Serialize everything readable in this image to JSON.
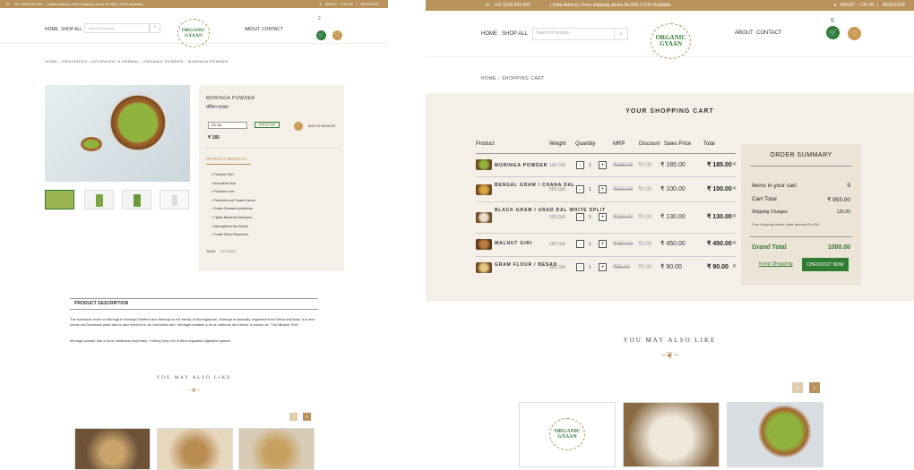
{
  "topbar": {
    "phone": "+91 9150 943 943",
    "promo": "| India delivery | Free shipping above Rs.600 | COD Available",
    "pincode": "400007",
    "login": "LOG IN",
    "register": "REGISTER"
  },
  "nav": {
    "home": "HOME",
    "shop_all": "SHOP ALL",
    "search_placeholder": "Search Products",
    "logo_line1": "ORGANIC",
    "logo_line2": "GYAAN",
    "about": "ABOUT",
    "contact": "CONTACT",
    "cart_count_left": "2",
    "cart_count_right": "5"
  },
  "product_page": {
    "breadcrumb": "HOME › GROCERIES › AYURVEDIC & HERBAL › ORGANIC POWDER › MORINGA POWDER",
    "name": "MORINGA POWDER",
    "name_local": "मोरिंगा पाउडर",
    "size_option": "100 GM",
    "add_to_cart": "Add to Cart",
    "add_to_wishlist": "ADD TO WISHLIST",
    "price": "₹ 185",
    "benefits_title": "PRODUCT BENEFITS",
    "benefits": [
      "Protects Skin",
      "Nourishes Hair",
      "Protects Liver",
      "Prevents and Treats Cancer",
      "Treats Stomach problems",
      "Fights Bacterial Diseases",
      "Strengthens the Bones",
      "Treats Mood Disorders"
    ],
    "tags_label": "TAGS:",
    "tag": "ORGANIC",
    "desc_title": "PRODUCT DESCRIPTION",
    "desc_p1": "The botanical name of Moringa is Moringa Oleifera and belongs to the family of Moringaceae. Moringa is basically originated from Africa and Asia. It is also known as Drumstick plant and is also referred to as Drumstick tree. Moringa contains a lot of nutrients and hence is known as \"The Miracle Tree\".",
    "desc_p2": "Moringa powder has a lot of medicinal properties. It being very rich in fibre regulates digestive system.",
    "also_like": "YOU MAY ALSO LIKE"
  },
  "cart_page": {
    "breadcrumb": "HOME › SHOPPING CART",
    "title": "YOUR SHOPPING CART",
    "headers": [
      "Product",
      "Weight",
      "Quantity",
      "MRP",
      "Discount",
      "Sales Price",
      "Total"
    ],
    "items": [
      {
        "name": "MORINGA POWDER",
        "weight": "100 GM",
        "qty": "1",
        "mrp": "₹185.00",
        "discount": "₹0.00",
        "sale": "₹ 185.00",
        "total": "₹ 185.00"
      },
      {
        "name": "BENGAL GRAM / CHANA DAL",
        "weight": "500 GM",
        "qty": "1",
        "mrp": "₹100.00",
        "discount": "₹0.00",
        "sale": "₹ 100.00",
        "total": "₹ 100.00"
      },
      {
        "name": "BLACK GRAM / URAD DAL WHITE SPLIT",
        "weight": "500 GM",
        "qty": "1",
        "mrp": "₹130.00",
        "discount": "₹0.00",
        "sale": "₹ 130.00",
        "total": "₹ 130.00"
      },
      {
        "name": "WALNUT GIRI",
        "weight": "250 GM",
        "qty": "1",
        "mrp": "₹450.00",
        "discount": "₹0.00",
        "sale": "₹ 450.00",
        "total": "₹ 450.00"
      },
      {
        "name": "GRAM FLOUR / BESAN",
        "weight": "500 GM",
        "qty": "1",
        "mrp": "₹90.00",
        "discount": "₹0.00",
        "sale": "₹ 90.00",
        "total": "₹ 90.00"
      }
    ],
    "summary": {
      "title": "ORDER SUMMARY",
      "items_label": "Items in your cart",
      "items_count": "5",
      "cart_total_label": "Cart Total",
      "cart_total": "₹ 955.00",
      "shipping_label": "Shipping Charges",
      "shipping": "125.00",
      "free_note": "Free shipping above order amount Rs.600",
      "grand_label": "Grand Total",
      "grand_total": "1080.00",
      "keep_shopping": "Keep Shopping",
      "checkout": "CHECKOUT NOW"
    },
    "also_like": "YOU MAY ALSO LIKE"
  },
  "colors": {
    "topbar": "#b8935c",
    "green": "#2f7d32",
    "gold": "#c99a52",
    "cream": "#f4f0e8"
  }
}
